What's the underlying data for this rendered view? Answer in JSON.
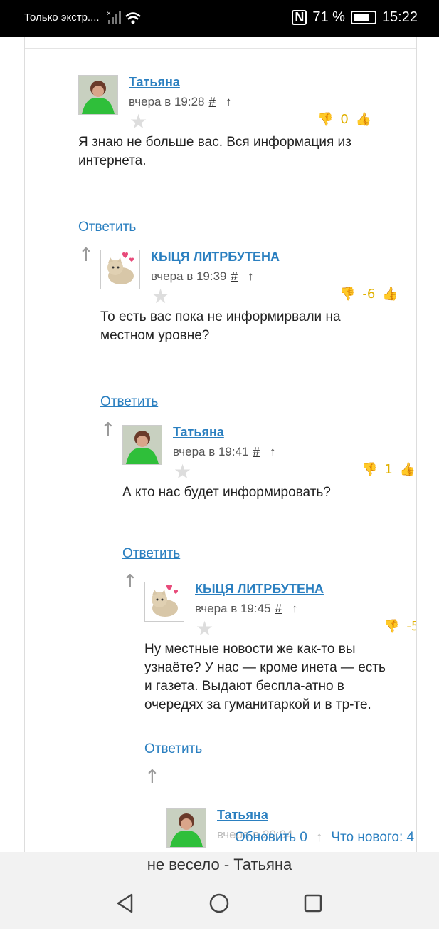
{
  "statusbar": {
    "left_text": "Только экстр....",
    "battery": "71 %",
    "time": "15:22"
  },
  "comments": [
    {
      "author": "Татьяна",
      "time": "вчера в 19:28",
      "hash": "#",
      "up": "↑",
      "score": "0",
      "text": "Я знаю не больше вас. Вся информация из интернета.",
      "reply": "Ответить",
      "parent": "↑"
    },
    {
      "author": "КЫЦЯ ЛИТРБУТЕНА",
      "time": "вчера в 19:39",
      "hash": "#",
      "up": "↑",
      "score": "-6",
      "text": "То есть вас пока не информирвали на местном уровне?",
      "reply": "Ответить",
      "parent": "↑"
    },
    {
      "author": "Татьяна",
      "time": "вчера в 19:41",
      "hash": "#",
      "up": "↑",
      "score": "1",
      "text": "А кто нас будет информировать?",
      "reply": "Ответить",
      "parent": "↑"
    },
    {
      "author": "КЫЦЯ ЛИТРБУТЕНА",
      "time": "вчера в 19:45",
      "hash": "#",
      "up": "↑",
      "score": "-5",
      "text": "Ну местные новости же как-то вы узнаёте? У нас — кроме инета — есть и газета. Выдают беспла-атно в очередях за гуманитаркой и в тр-те.",
      "reply": "Ответить",
      "parent": "↑"
    },
    {
      "author": "Татьяна",
      "time": "вчера в 20:04",
      "hash": "#",
      "up": "↑",
      "score": "",
      "text": "",
      "reply": "",
      "parent": ""
    }
  ],
  "toolbar": {
    "refresh": "Обновить 0",
    "whats_new": "Что нового: 4"
  },
  "page_title": "не весело - Татьяна",
  "colors": {
    "link": "#2a7fc0",
    "score": "#e0b000",
    "dislike": "#e04545",
    "like": "#5aa040"
  }
}
